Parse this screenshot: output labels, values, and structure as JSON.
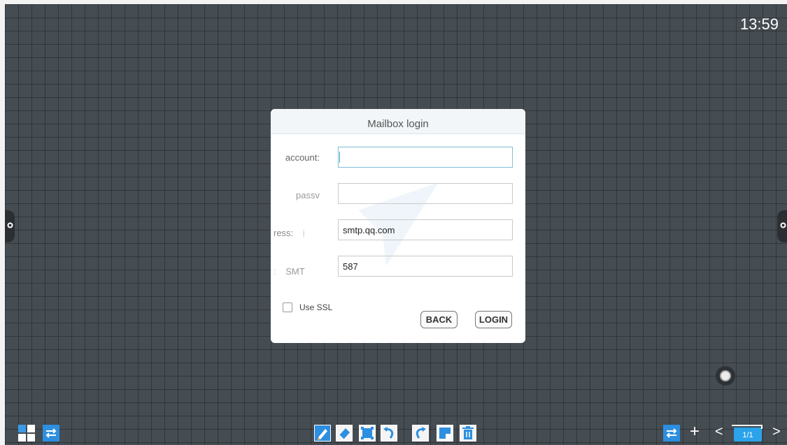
{
  "status": {
    "time": "13:59"
  },
  "dialog": {
    "title": "Mailbox login",
    "fields": [
      {
        "label": "account:",
        "value": "",
        "placeholder": ""
      },
      {
        "label": "passv",
        "value": "",
        "placeholder": ""
      },
      {
        "label": "ress:",
        "label_prefix": "ị",
        "value": "smtp.qq.com",
        "placeholder": ""
      },
      {
        "label": "SMT",
        "label_prefix": ":",
        "value": "587",
        "placeholder": ""
      }
    ],
    "ssl_label": "Use SSL",
    "ssl_checked": false,
    "back_label": "BACK",
    "login_label": "LOGIN"
  },
  "toolbar": {
    "center_icons": [
      "pen-icon",
      "eraser-icon",
      "select-icon",
      "undo-icon",
      "redo-icon",
      "screenshot-icon",
      "delete-icon"
    ],
    "left_icons": [
      "grid-menu-icon",
      "switch-icon"
    ],
    "right_icons": [
      "switch-icon",
      "add-page-icon",
      "prev-page-icon",
      "next-page-icon"
    ]
  },
  "pagination": {
    "current": "1/1"
  },
  "colors": {
    "board": "#454c52",
    "accent": "#2d8fe0",
    "page_indicator": "#2aa3ea"
  }
}
